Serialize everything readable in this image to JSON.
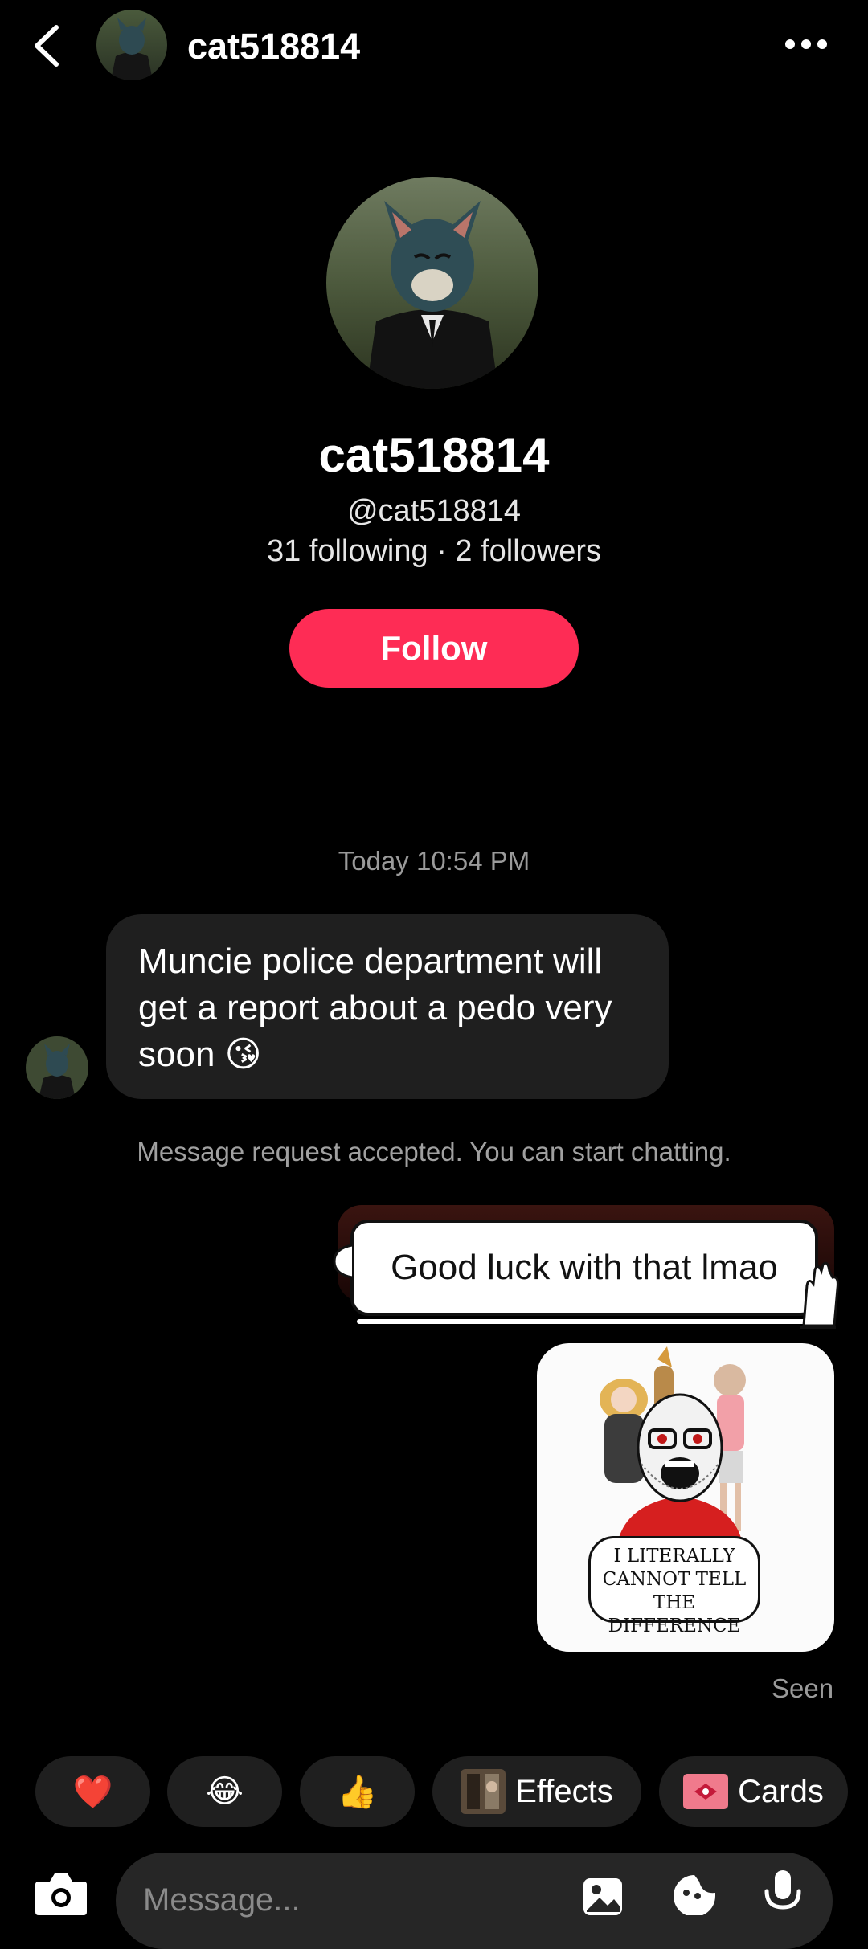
{
  "header": {
    "username": "cat518814"
  },
  "profile": {
    "display_name": "cat518814",
    "handle": "@cat518814",
    "stats": "31 following · 2 followers",
    "follow_label": "Follow"
  },
  "chat": {
    "timestamp": "Today 10:54 PM",
    "incoming_message": "Muncie police department will get a report about a pedo very soon 😘",
    "request_note": "Message request accepted. You can start chatting.",
    "outgoing_message": "Good luck with that lmao",
    "image_caption": "I LITERALLY CANNOT TELL THE DIFFERENCE",
    "seen": "Seen"
  },
  "quick_reactions": {
    "heart": "❤️",
    "laugh": "😂",
    "thumbs": "👍",
    "effects_label": "Effects",
    "cards_label": "Cards"
  },
  "composer": {
    "placeholder": "Message..."
  },
  "colors": {
    "accent": "#fe2c55",
    "bubble": "#1f1f1f",
    "input": "#262626"
  }
}
